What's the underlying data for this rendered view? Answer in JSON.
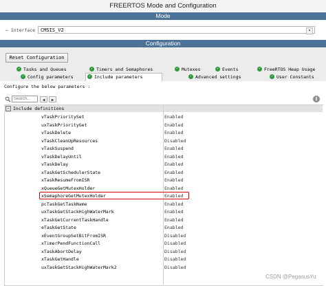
{
  "window": {
    "title": "FREERTOS Mode and Configuration"
  },
  "mode_section": {
    "title": "Mode"
  },
  "interface": {
    "label": "Interface",
    "value": "CMSIS_V2"
  },
  "config_section": {
    "title": "Configuration"
  },
  "reset_button": "Reset Configuration",
  "tabs_row1": [
    "Tasks and Queues",
    "Timers and Semaphores",
    "Mutexes",
    "Events",
    "FreeRTOS Heap Usage"
  ],
  "tabs_row2": [
    "Config parameters",
    "Include parameters",
    "Advanced settings",
    "User Constants"
  ],
  "active_tab": "Include parameters",
  "configure_label": "Configure the below parameters :",
  "search": {
    "placeholder": "Search..."
  },
  "group": {
    "title": "Include definitions"
  },
  "parameters": [
    {
      "name": "vTaskPrioritySet",
      "value": "Enabled"
    },
    {
      "name": "uxTaskPriorityGet",
      "value": "Enabled"
    },
    {
      "name": "vTaskDelete",
      "value": "Enabled"
    },
    {
      "name": "vTaskCleanUpResources",
      "value": "Disabled"
    },
    {
      "name": "vTaskSuspend",
      "value": "Enabled"
    },
    {
      "name": "vTaskDelayUntil",
      "value": "Enabled"
    },
    {
      "name": "vTaskDelay",
      "value": "Enabled"
    },
    {
      "name": "xTaskGetSchedulerState",
      "value": "Enabled"
    },
    {
      "name": "xTaskResumeFromISR",
      "value": "Enabled"
    },
    {
      "name": "xQueueGetMutexHolder",
      "value": "Enabled"
    },
    {
      "name": "xSemaphoreGetMutexHolder",
      "value": "Enabled"
    },
    {
      "name": "pcTaskGetTaskName",
      "value": "Enabled"
    },
    {
      "name": "uxTaskGetStackHighWaterMark",
      "value": "Enabled"
    },
    {
      "name": "xTaskGetCurrentTaskHandle",
      "value": "Enabled"
    },
    {
      "name": "eTaskGetState",
      "value": "Enabled"
    },
    {
      "name": "xEventGroupSetBitFromISR",
      "value": "Disabled"
    },
    {
      "name": "xTimerPendFunctionCall",
      "value": "Disabled"
    },
    {
      "name": "xTaskAbortDelay",
      "value": "Disabled"
    },
    {
      "name": "xTaskGetHandle",
      "value": "Disabled"
    },
    {
      "name": "uxTaskGetStackHighWaterMark2",
      "value": "Disabled"
    }
  ],
  "highlighted_parameter": "xSemaphoreGetMutexHolder",
  "watermark": "CSDN @PegasusYu",
  "colors": {
    "section_bar": "#4d7298",
    "tab_check": "#2a9a3c",
    "highlight": "#d40000"
  }
}
